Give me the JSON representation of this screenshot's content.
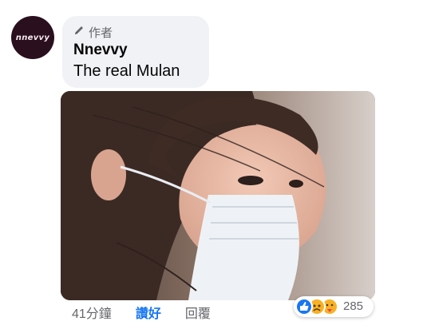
{
  "post": {
    "avatar_text": "nnevvy",
    "role_label": "作者",
    "role_icon": "pencil-icon",
    "author_name": "Nnevvy",
    "comment_text": "The real Mulan",
    "time_ago": "41分鐘",
    "like_label": "讚好",
    "reply_label": "回覆",
    "reaction_count": "285",
    "reactions": [
      "like-icon",
      "sad-icon",
      "care-icon"
    ]
  },
  "colors": {
    "bubble": "#f0f2f5",
    "link_blue": "#1877f2",
    "meta_gray": "#65676b",
    "avatar_bg": "#2a0f1e"
  }
}
